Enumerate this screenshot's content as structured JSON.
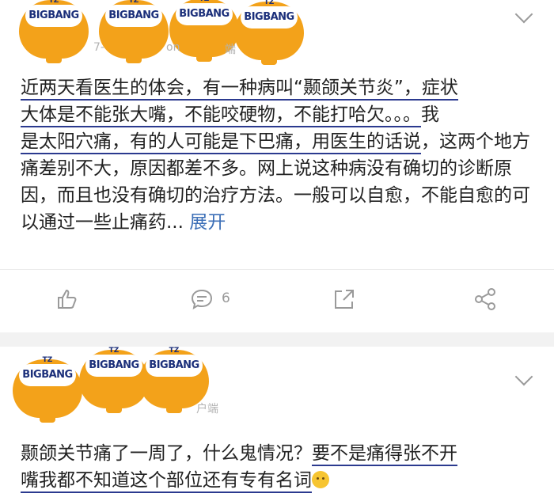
{
  "sticker_text": {
    "top": "TZ",
    "main": "BIGBANG"
  },
  "post1": {
    "meta_fragments": [
      "7-",
      "on",
      "端"
    ],
    "body_underlined_1": "近两天看医生的体会，有一种病叫“颞颌关节炎”，症状",
    "body_underlined_2": "大体是不能张大嘴，不能咬硬物，不能打哈欠。。。",
    "body_underlined_3": "是太阳穴痛，有的人可能是下巴痛，用医生的话说",
    "body_plain_1": "我",
    "body_plain_2": "，这两个地方痛差别不大，原因都差不多。网上说这种病没有确切的诊断原因，而且也没有确切的治疗方法。一般可以自愈，不能自愈的可以通过一些止痛药...",
    "expand_label": "展开",
    "comment_count": "6"
  },
  "post2": {
    "meta_fragment": "户端",
    "body_plain": "颞颌关节痛了一周了，什么鬼情况？",
    "body_underlined_1": "要不是痛得张不开",
    "body_underlined_2": "嘴我都不知道这个部位还有专有名词"
  },
  "colors": {
    "sticker": "#f3a21a",
    "link": "#3c6fb7",
    "underline": "#2b3a8f"
  },
  "icons": [
    "like-icon",
    "comment-icon",
    "share-icon",
    "forward-icon",
    "chevron-down-icon",
    "upside-down-face-emoji"
  ]
}
